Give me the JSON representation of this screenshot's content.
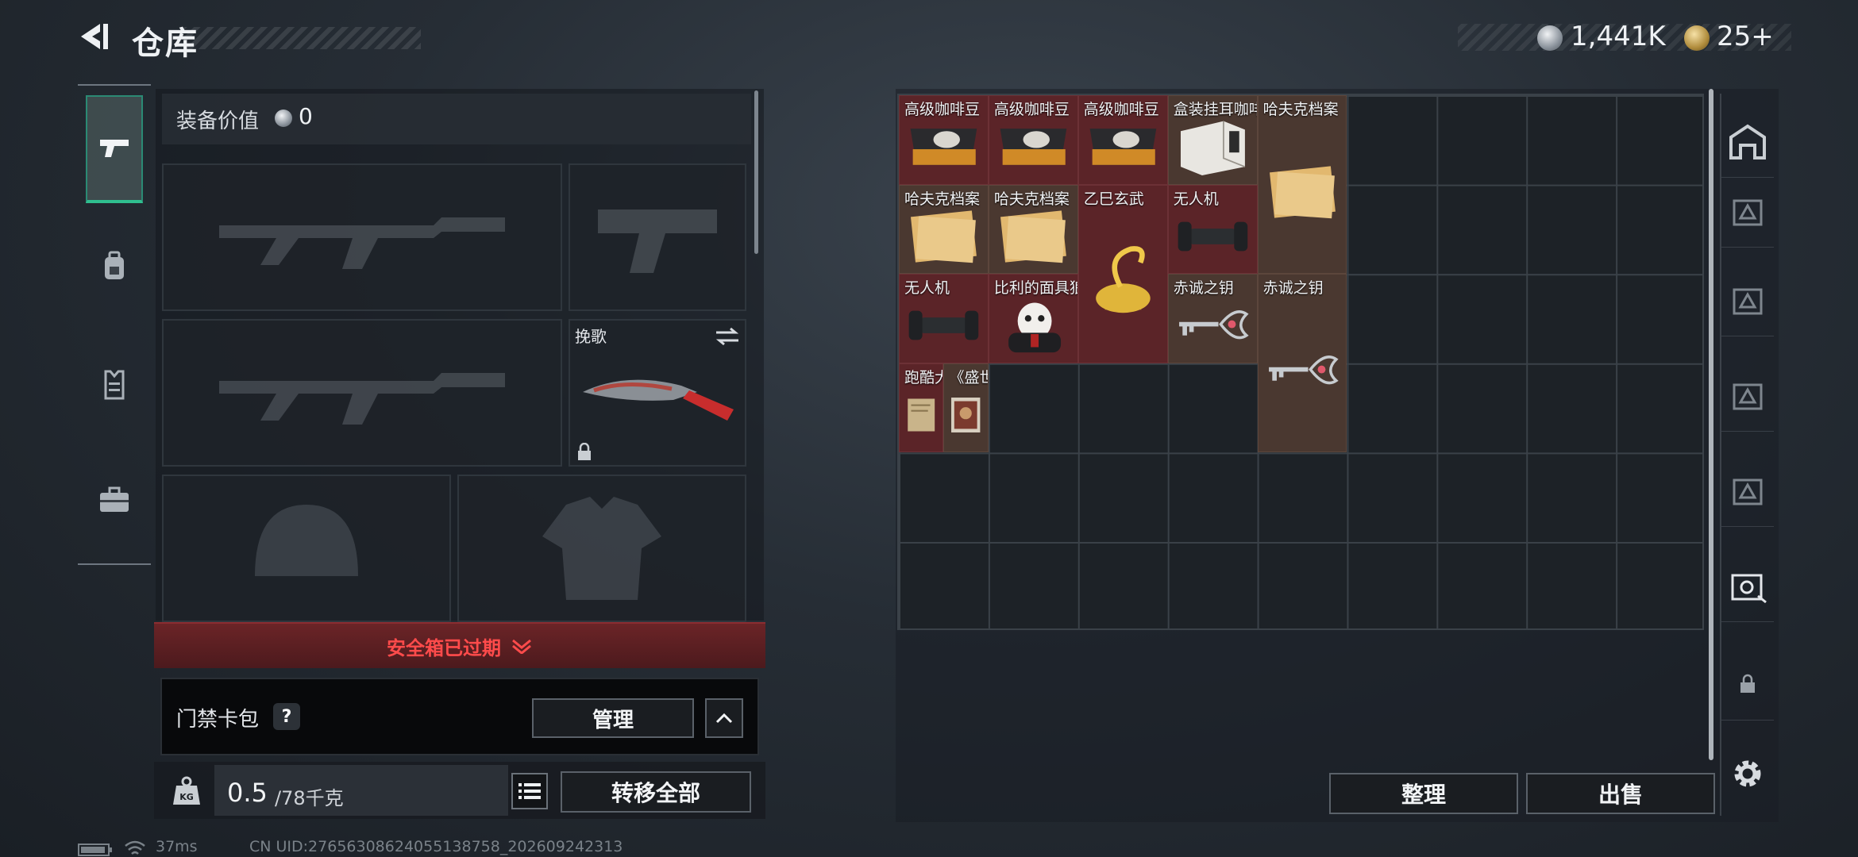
{
  "header": {
    "title": "仓库",
    "currency": [
      {
        "icon": "silver-coin-icon",
        "value": "1,441K"
      },
      {
        "icon": "gold-coin-icon",
        "value": "25+"
      }
    ]
  },
  "left_nav": {
    "items": [
      {
        "name": "weapons-tab",
        "icon": "pistol-icon",
        "active": true
      },
      {
        "name": "gear-tab",
        "icon": "backpack-icon",
        "active": false
      },
      {
        "name": "vest-tab",
        "icon": "vest-icon",
        "active": false
      },
      {
        "name": "case-tab",
        "icon": "briefcase-icon",
        "active": false
      }
    ]
  },
  "equipment": {
    "value_label": "装备价值",
    "value": "0",
    "melee_label": "挽歌",
    "safe_box_status": "安全箱已过期",
    "access_card_label": "门禁卡包",
    "help_label": "?",
    "manage_label": "管理",
    "weight_value": "0.5",
    "weight_capacity": "/78千克",
    "transfer_all_label": "转移全部"
  },
  "storage": {
    "items": [
      {
        "name": "高级咖啡豆",
        "style": "red",
        "art": "coffee"
      },
      {
        "name": "高级咖啡豆",
        "style": "red",
        "art": "coffee"
      },
      {
        "name": "高级咖啡豆",
        "style": "red",
        "art": "coffee"
      },
      {
        "name": "盒装挂耳咖啡",
        "style": "brown",
        "art": "box"
      },
      {
        "name": "哈夫克档案",
        "style": "brown",
        "art": "folder"
      },
      {
        "name": "哈夫克档案",
        "style": "brown",
        "art": "folder"
      },
      {
        "name": "哈夫克档案",
        "style": "brown",
        "art": "folder"
      },
      {
        "name": "乙巳玄武",
        "style": "red",
        "art": "gold"
      },
      {
        "name": "无人机",
        "style": "red",
        "art": "drone"
      },
      {
        "name": "无人机",
        "style": "red",
        "art": "drone"
      },
      {
        "name": "比利的面具狼",
        "style": "red",
        "art": "puppet"
      },
      {
        "name": "赤诚之钥",
        "style": "brown",
        "art": "key"
      },
      {
        "name": "赤诚之钥",
        "style": "brown",
        "art": "key"
      },
      {
        "name": "跑酷大师…",
        "style": "red",
        "art": "paper"
      },
      {
        "name": "《盛世天…",
        "style": "brown",
        "art": "book"
      }
    ],
    "tidy_label": "整理",
    "sell_label": "出售"
  },
  "status_bar": {
    "latency": "37ms",
    "uid": "CN UID:27656308624055138758_202609242313"
  }
}
